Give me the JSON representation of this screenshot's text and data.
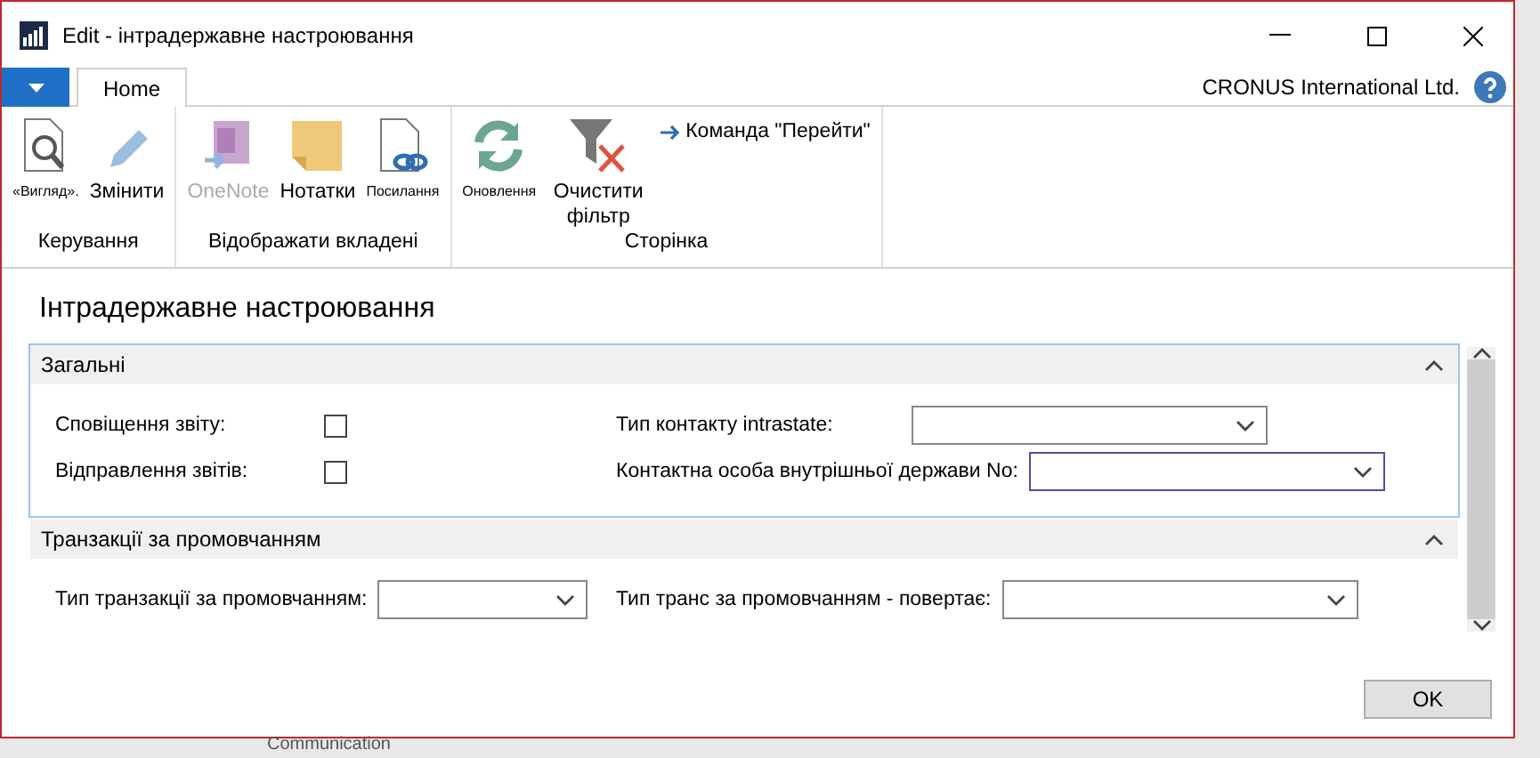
{
  "window": {
    "title": "Edit - інтрадержавне настроювання"
  },
  "tabs": [
    {
      "label": "Home",
      "selected": true
    }
  ],
  "company": "CRONUS International Ltd.",
  "ribbon": {
    "groups": [
      {
        "label": "Керування",
        "buttons": [
          {
            "label": "«Вигляд».",
            "disabled": false
          },
          {
            "label": "Змінити",
            "disabled": false
          }
        ]
      },
      {
        "label": "Відображати вкладені",
        "buttons": [
          {
            "label": "OneNote",
            "disabled": true
          },
          {
            "label": "Нотатки",
            "disabled": false
          },
          {
            "label": "Посилання",
            "disabled": false
          }
        ]
      },
      {
        "label": "Сторінка",
        "buttons": [
          {
            "label": "Оновлення",
            "disabled": false
          },
          {
            "label": "Очистити фільтр",
            "disabled": false
          }
        ],
        "link": "Команда \"Перейти\""
      }
    ]
  },
  "page_title": "Інтрадержавне настроювання",
  "sections": [
    {
      "title": "Загальні",
      "expanded": true,
      "focused": true,
      "left": [
        {
          "label": "Сповіщення звіту:",
          "kind": "checkbox",
          "checked": false
        },
        {
          "label": "Відправлення звітів:",
          "kind": "checkbox",
          "checked": false
        }
      ],
      "right": [
        {
          "label": "Тип контакту intrastate:",
          "kind": "dropdown",
          "focused": false
        },
        {
          "label": "Контактна особа внутрішньої держави No:",
          "kind": "dropdown",
          "focused": true
        }
      ]
    },
    {
      "title": "Транзакції за промовчанням",
      "expanded": true,
      "focused": false,
      "left": [
        {
          "label": "Тип транзакції за промовчанням:",
          "kind": "dropdown",
          "focused": false
        }
      ],
      "right": [
        {
          "label": "Тип транс за промовчанням - повертає:",
          "kind": "dropdown",
          "focused": false
        }
      ]
    }
  ],
  "ok_button": "OK",
  "background_text": "Communication"
}
